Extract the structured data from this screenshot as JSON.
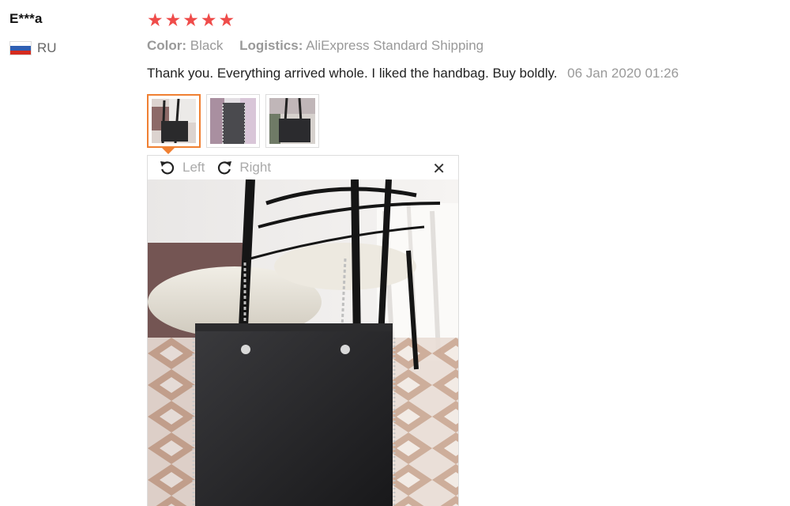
{
  "reviewer": {
    "name": "E***a",
    "country": "RU",
    "flag_icon": "russia-flag-icon"
  },
  "rating": {
    "stars": 5,
    "max": 5,
    "color": "#ef4c4a"
  },
  "attributes": [
    {
      "label": "Color:",
      "value": "Black"
    },
    {
      "label": "Logistics:",
      "value": "AliExpress Standard Shipping"
    }
  ],
  "review": {
    "text": "Thank you. Everything arrived whole. I liked the handbag. Buy boldly.",
    "date": "06 Jan 2020 01:26"
  },
  "thumbnails": {
    "count": 3,
    "active_index": 0,
    "active_color": "#f08032"
  },
  "viewer": {
    "rotate_left_label": "Left",
    "rotate_right_label": "Right",
    "rotate_left_icon": "rotate-left-icon",
    "rotate_right_icon": "rotate-right-icon",
    "close_icon": "close-icon",
    "close_glyph": "✕"
  }
}
